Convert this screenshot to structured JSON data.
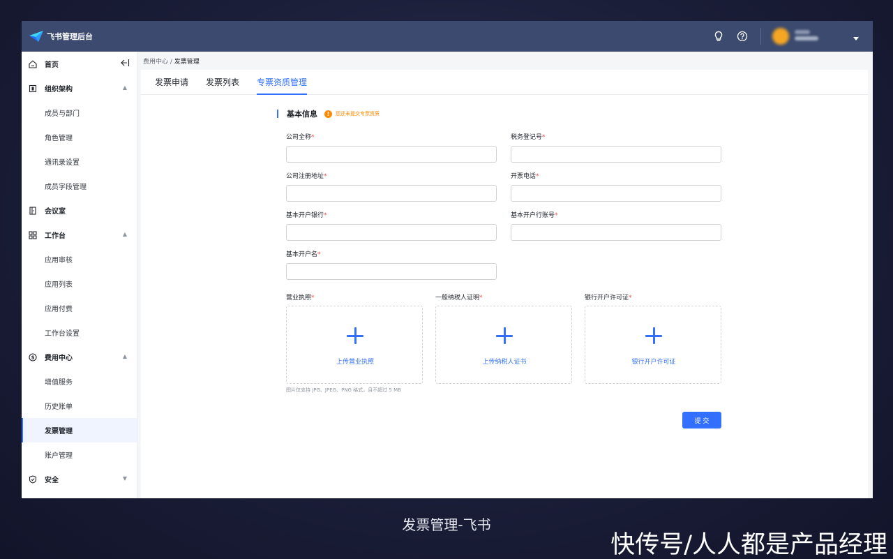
{
  "app": {
    "title": "飞书管理后台"
  },
  "sidebar": {
    "items": [
      {
        "label": "首页",
        "type": "top",
        "icon": "home-icon"
      },
      {
        "label": "组织架构",
        "type": "top",
        "icon": "org-icon",
        "expanded": true
      },
      {
        "label": "成员与部门",
        "type": "sub"
      },
      {
        "label": "角色管理",
        "type": "sub"
      },
      {
        "label": "通讯录设置",
        "type": "sub"
      },
      {
        "label": "成员字段管理",
        "type": "sub"
      },
      {
        "label": "会议室",
        "type": "top",
        "icon": "door-icon"
      },
      {
        "label": "工作台",
        "type": "top",
        "icon": "grid-icon",
        "expanded": true
      },
      {
        "label": "应用审核",
        "type": "sub"
      },
      {
        "label": "应用列表",
        "type": "sub"
      },
      {
        "label": "应用付费",
        "type": "sub"
      },
      {
        "label": "工作台设置",
        "type": "sub"
      },
      {
        "label": "费用中心",
        "type": "top",
        "icon": "dollar-icon",
        "expanded": true
      },
      {
        "label": "增值服务",
        "type": "sub"
      },
      {
        "label": "历史账单",
        "type": "sub"
      },
      {
        "label": "发票管理",
        "type": "sub",
        "active": true
      },
      {
        "label": "账户管理",
        "type": "sub"
      },
      {
        "label": "安全",
        "type": "top",
        "icon": "shield-icon",
        "expanded": false
      }
    ]
  },
  "breadcrumb": {
    "parent": "费用中心",
    "separator": " / ",
    "current": "发票管理"
  },
  "tabs": [
    {
      "label": "发票申请",
      "active": false
    },
    {
      "label": "发票列表",
      "active": false
    },
    {
      "label": "专票资质管理",
      "active": true
    }
  ],
  "form": {
    "section_title": "基本信息",
    "warning": "您还未提交专票资质",
    "required_mark": "*",
    "fields": {
      "company_name": {
        "label": "公司全称",
        "value": ""
      },
      "tax_id": {
        "label": "税务登记号",
        "value": ""
      },
      "reg_address": {
        "label": "公司注册地址",
        "value": ""
      },
      "invoice_phone": {
        "label": "开票电话",
        "value": ""
      },
      "bank": {
        "label": "基本开户银行",
        "value": ""
      },
      "bank_account": {
        "label": "基本开户行账号",
        "value": ""
      },
      "account_name": {
        "label": "基本开户名",
        "value": ""
      }
    },
    "uploads": [
      {
        "label": "营业执照",
        "button": "上传营业执照"
      },
      {
        "label": "一般纳税人证明",
        "button": "上传纳税人证书"
      },
      {
        "label": "银行开户许可证",
        "button": "银行开户许可证"
      }
    ],
    "upload_hint": "图片仅支持 JPG、JPEG、PNG 格式，且不超过 5 MB",
    "submit_label": "提 交"
  },
  "caption": "发票管理-飞书",
  "watermark": "快传号/人人都是产品经理",
  "colors": {
    "accent": "#3370ff",
    "topbar": "#3b4a6e",
    "warning": "#ff8800",
    "required": "#f54a45"
  }
}
